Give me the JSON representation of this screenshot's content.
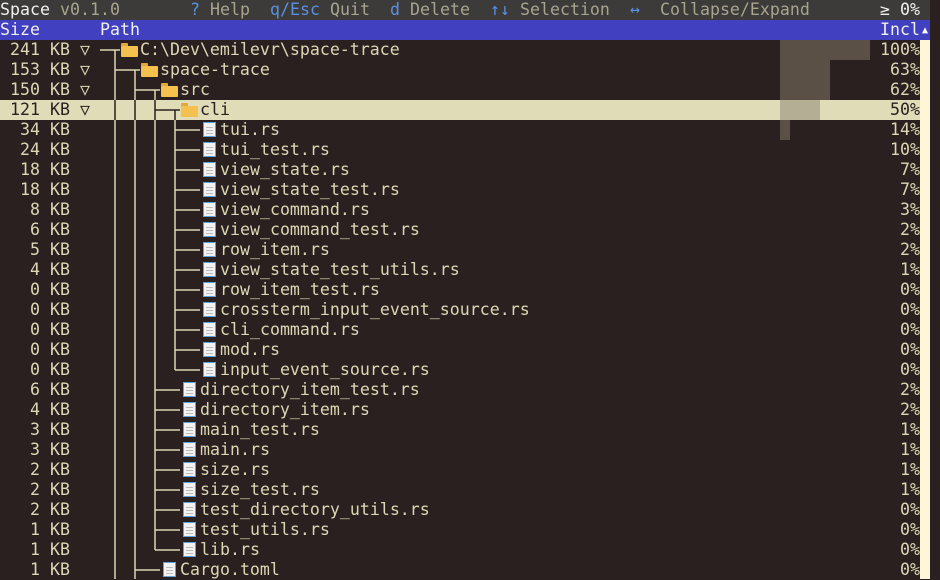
{
  "title": {
    "app": "Space",
    "version": "v0.1.0",
    "threshold": "≥ 0%"
  },
  "shortcuts": [
    {
      "key": "?",
      "label": "Help"
    },
    {
      "key": "q/Esc",
      "label": "Quit"
    },
    {
      "key": "d",
      "label": "Delete"
    },
    {
      "key": "↑↓",
      "label": "Selection"
    },
    {
      "key": "↔",
      "label": "Collapse/Expand"
    }
  ],
  "header": {
    "size": "Size",
    "path": "Path",
    "incl": "Incl"
  },
  "colors": {
    "background": "#2a201f",
    "header": "#4040c0",
    "selected": "#e0dcb8",
    "bar": "#5a5046",
    "key": "#5a90e0"
  },
  "rows": [
    {
      "size": "241 KB",
      "expanded": true,
      "depth": 0,
      "type": "folder",
      "name": "C:\\Dev\\emilevr\\space-trace",
      "incl": "100%",
      "pct": 100
    },
    {
      "size": "153 KB",
      "expanded": true,
      "depth": 1,
      "type": "folder",
      "name": "space-trace",
      "incl": "63%",
      "pct": 63
    },
    {
      "size": "150 KB",
      "expanded": true,
      "depth": 2,
      "type": "folder",
      "name": "src",
      "incl": "62%",
      "pct": 62
    },
    {
      "size": "121 KB",
      "expanded": true,
      "depth": 3,
      "type": "folder",
      "name": "cli",
      "incl": "50%",
      "pct": 50,
      "selected": true
    },
    {
      "size": "34 KB",
      "depth": 4,
      "type": "file",
      "name": "tui.rs",
      "incl": "14%",
      "pct": 14
    },
    {
      "size": "24 KB",
      "depth": 4,
      "type": "file",
      "name": "tui_test.rs",
      "incl": "10%",
      "pct": 10
    },
    {
      "size": "18 KB",
      "depth": 4,
      "type": "file",
      "name": "view_state.rs",
      "incl": "7%",
      "pct": 7
    },
    {
      "size": "18 KB",
      "depth": 4,
      "type": "file",
      "name": "view_state_test.rs",
      "incl": "7%",
      "pct": 7
    },
    {
      "size": "8 KB",
      "depth": 4,
      "type": "file",
      "name": "view_command.rs",
      "incl": "3%",
      "pct": 3
    },
    {
      "size": "6 KB",
      "depth": 4,
      "type": "file",
      "name": "view_command_test.rs",
      "incl": "2%",
      "pct": 2
    },
    {
      "size": "5 KB",
      "depth": 4,
      "type": "file",
      "name": "row_item.rs",
      "incl": "2%",
      "pct": 2
    },
    {
      "size": "4 KB",
      "depth": 4,
      "type": "file",
      "name": "view_state_test_utils.rs",
      "incl": "1%",
      "pct": 1
    },
    {
      "size": "0 KB",
      "depth": 4,
      "type": "file",
      "name": "row_item_test.rs",
      "incl": "0%",
      "pct": 0
    },
    {
      "size": "0 KB",
      "depth": 4,
      "type": "file",
      "name": "crossterm_input_event_source.rs",
      "incl": "0%",
      "pct": 0
    },
    {
      "size": "0 KB",
      "depth": 4,
      "type": "file",
      "name": "cli_command.rs",
      "incl": "0%",
      "pct": 0
    },
    {
      "size": "0 KB",
      "depth": 4,
      "type": "file",
      "name": "mod.rs",
      "incl": "0%",
      "pct": 0
    },
    {
      "size": "0 KB",
      "depth": 4,
      "type": "file",
      "name": "input_event_source.rs",
      "incl": "0%",
      "pct": 0
    },
    {
      "size": "6 KB",
      "depth": 3,
      "type": "file",
      "name": "directory_item_test.rs",
      "incl": "2%",
      "pct": 2
    },
    {
      "size": "4 KB",
      "depth": 3,
      "type": "file",
      "name": "directory_item.rs",
      "incl": "2%",
      "pct": 2
    },
    {
      "size": "3 KB",
      "depth": 3,
      "type": "file",
      "name": "main_test.rs",
      "incl": "1%",
      "pct": 1
    },
    {
      "size": "3 KB",
      "depth": 3,
      "type": "file",
      "name": "main.rs",
      "incl": "1%",
      "pct": 1
    },
    {
      "size": "2 KB",
      "depth": 3,
      "type": "file",
      "name": "size.rs",
      "incl": "1%",
      "pct": 1
    },
    {
      "size": "2 KB",
      "depth": 3,
      "type": "file",
      "name": "size_test.rs",
      "incl": "1%",
      "pct": 1
    },
    {
      "size": "2 KB",
      "depth": 3,
      "type": "file",
      "name": "test_directory_utils.rs",
      "incl": "0%",
      "pct": 0
    },
    {
      "size": "1 KB",
      "depth": 3,
      "type": "file",
      "name": "test_utils.rs",
      "incl": "0%",
      "pct": 0
    },
    {
      "size": "1 KB",
      "depth": 3,
      "type": "file",
      "name": "lib.rs",
      "incl": "0%",
      "pct": 0
    },
    {
      "size": "1 KB",
      "depth": 2,
      "type": "file",
      "name": "Cargo.toml",
      "incl": "0%",
      "pct": 0
    }
  ]
}
